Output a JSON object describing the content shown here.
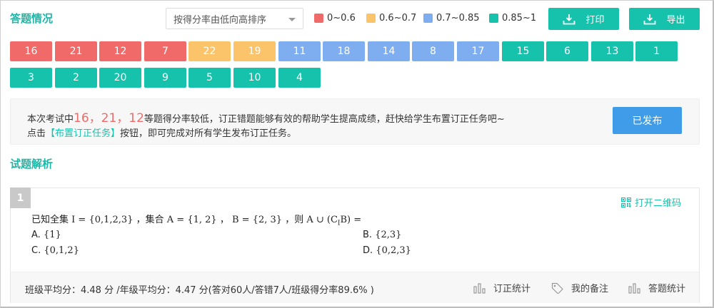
{
  "answer_section": {
    "title": "答题情况",
    "sort_select": {
      "value": "按得分率由低向高排序"
    },
    "legend": [
      {
        "label": "0~0.6",
        "color": "#f16a6a"
      },
      {
        "label": "0.6~0.7",
        "color": "#fbc46b"
      },
      {
        "label": "0.7~0.85",
        "color": "#7faef0"
      },
      {
        "label": "0.85~1",
        "color": "#17c2ad"
      }
    ],
    "print_label": "打印",
    "export_label": "导出",
    "questions": [
      {
        "num": "16",
        "color": "#f16a6a"
      },
      {
        "num": "21",
        "color": "#f16a6a"
      },
      {
        "num": "12",
        "color": "#f16a6a"
      },
      {
        "num": "7",
        "color": "#f16a6a"
      },
      {
        "num": "22",
        "color": "#fbc46b"
      },
      {
        "num": "19",
        "color": "#fbc46b"
      },
      {
        "num": "11",
        "color": "#7faef0"
      },
      {
        "num": "18",
        "color": "#7faef0"
      },
      {
        "num": "14",
        "color": "#7faef0"
      },
      {
        "num": "8",
        "color": "#7faef0"
      },
      {
        "num": "17",
        "color": "#7faef0"
      },
      {
        "num": "15",
        "color": "#17c2ad"
      },
      {
        "num": "6",
        "color": "#17c2ad"
      },
      {
        "num": "13",
        "color": "#17c2ad"
      },
      {
        "num": "1",
        "color": "#17c2ad"
      },
      {
        "num": "3",
        "color": "#17c2ad"
      },
      {
        "num": "2",
        "color": "#17c2ad"
      },
      {
        "num": "20",
        "color": "#17c2ad"
      },
      {
        "num": "9",
        "color": "#17c2ad"
      },
      {
        "num": "5",
        "color": "#17c2ad"
      },
      {
        "num": "10",
        "color": "#17c2ad"
      },
      {
        "num": "4",
        "color": "#17c2ad"
      }
    ]
  },
  "notice": {
    "prefix": "本次考试中",
    "low_questions": "16，21，12",
    "suffix": "等题得分率较低，订正错题能够有效的帮助学生提高成绩，赶快给学生布置订正任务吧~",
    "line2_prefix": "点击",
    "line2_link": "【布置订正任务】",
    "line2_suffix": "按钮，即可完成对所有学生发布订正任务。",
    "published_button": "已发布"
  },
  "analysis_section": {
    "title": "试题解析"
  },
  "question1": {
    "num": "1",
    "qr_link": "打开二维码",
    "stem_parts": {
      "p1": "已知全集",
      "m1": "I = {0,1,2,3}",
      "p2": "，集合",
      "m2": "A = {1, 2}",
      "p3": "，",
      "m3": "B = {2, 3}",
      "p4": "，则",
      "m4": "A ∪ (C",
      "m4sub": "I",
      "m4end": "B) ="
    },
    "options": {
      "a_label": "A.",
      "a_value": "{1}",
      "b_label": "B.",
      "b_value": "{2,3}",
      "c_label": "C.",
      "c_value": "{0,1,2}",
      "d_label": "D.",
      "d_value": "{0,2,3}"
    },
    "stats": "班级平均分：4.48 分 /年级平均分：4.47 分(答对60人/答错7人/班级得分率89.6% )",
    "actions": {
      "correction_stats": "订正统计",
      "my_notes": "我的备注",
      "answer_stats": "答题统计"
    }
  }
}
